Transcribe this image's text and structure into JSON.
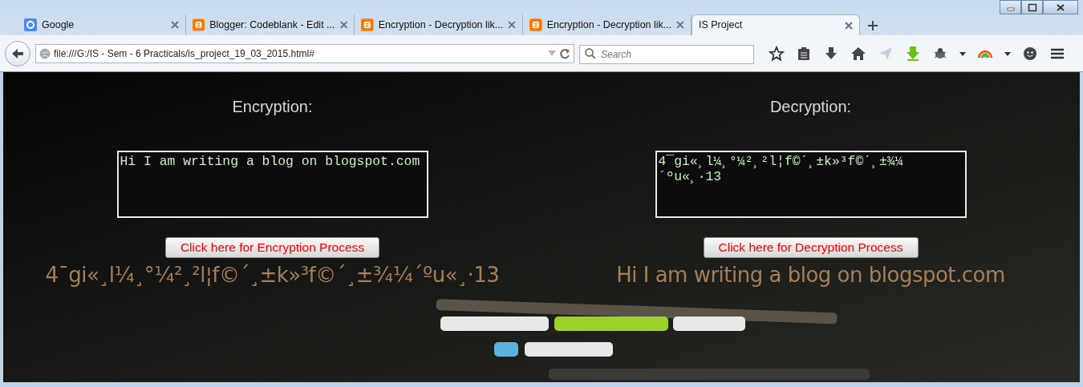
{
  "tabs": [
    {
      "title": "Google",
      "kind": "google",
      "selected": false
    },
    {
      "title": "Blogger: Codeblank - Edit ...",
      "kind": "blogger",
      "selected": false
    },
    {
      "title": "Encryption - Decryption lik...",
      "kind": "blogger",
      "selected": false
    },
    {
      "title": "Encryption - Decryption lik...",
      "kind": "blogger",
      "selected": false
    },
    {
      "title": "IS Project",
      "kind": "plain",
      "selected": true
    }
  ],
  "address_bar": {
    "url": "file:///G:/IS - Sem - 6 Practicals/is_project_19_03_2015.html#"
  },
  "search": {
    "placeholder": "Search"
  },
  "toolbar": [
    {
      "kind": "star"
    },
    {
      "kind": "reader"
    },
    {
      "kind": "download"
    },
    {
      "kind": "home"
    },
    {
      "kind": "send"
    },
    {
      "kind": "green-download"
    },
    {
      "kind": "bug"
    },
    {
      "kind": "dropdown"
    },
    {
      "kind": "rainbow"
    },
    {
      "kind": "dropdown"
    },
    {
      "kind": "chat"
    },
    {
      "kind": "menu"
    }
  ],
  "page": {
    "panels": [
      {
        "heading": "Encryption:",
        "textarea": "Hi I am writing a blog on blogspot.com",
        "button": "Click here for Encryption Process",
        "result": "4¯gi«¸l¼¸°¼²¸²l¦f©´¸±k»³f©´¸±¾¼´ºu«¸·13"
      },
      {
        "heading": "Decryption:",
        "textarea": "4¯gi«¸l¼¸°¼²¸²l¦f©´¸±k»³f©´¸±¾¼´ºu«¸·13",
        "button": "Click here for Decryption Process",
        "result": "Hi I am writing a blog on blogspot.com"
      }
    ]
  }
}
